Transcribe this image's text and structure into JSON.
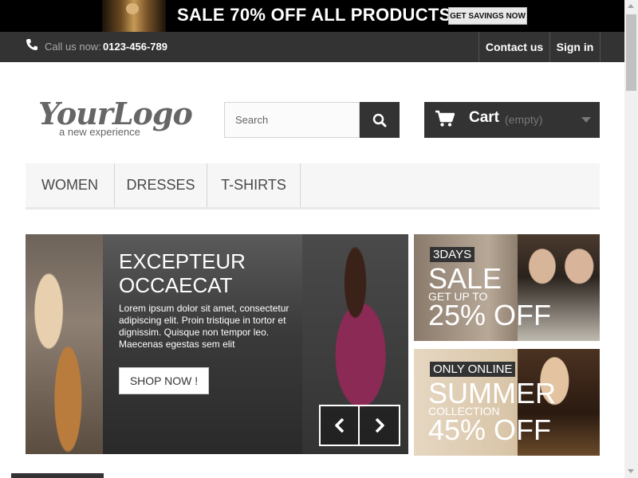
{
  "promo": {
    "text": "SALE 70% OFF ALL PRODUCTS",
    "button_label": "GET SAVINGS NOW"
  },
  "topbar": {
    "call_label": "Call us now:",
    "call_number": "0123-456-789",
    "links": {
      "contact": "Contact us",
      "signin": "Sign in"
    }
  },
  "header": {
    "logo": {
      "main": "YourLogo",
      "tagline": "a new experience"
    },
    "search": {
      "placeholder": "Search",
      "value": ""
    },
    "cart": {
      "label": "Cart",
      "status": "(empty)"
    }
  },
  "menu": {
    "items": [
      "WOMEN",
      "DRESSES",
      "T-SHIRTS"
    ]
  },
  "slider": {
    "title_line1": "EXCEPTEUR",
    "title_line2": "OCCAECAT",
    "description": "Lorem ipsum dolor sit amet, consectetur adipiscing elit. Proin tristique in tortor et dignissim. Quisque non tempor leo. Maecenas egestas sem elit",
    "button": "SHOP NOW !"
  },
  "banners": [
    {
      "tag": "3DAYS",
      "headline": "SALE",
      "sub": "GET UP TO",
      "offer": "25% OFF"
    },
    {
      "tag": "ONLY ONLINE",
      "headline": "SUMMER",
      "sub": "COLLECTION",
      "offer": "45% OFF"
    }
  ],
  "colors": {
    "dark": "#333333",
    "accent_white": "#ffffff",
    "menu_bg": "#f6f6f6"
  },
  "icons": [
    "phone-icon",
    "search-icon",
    "cart-icon",
    "chevron-left-icon",
    "chevron-right-icon"
  ]
}
